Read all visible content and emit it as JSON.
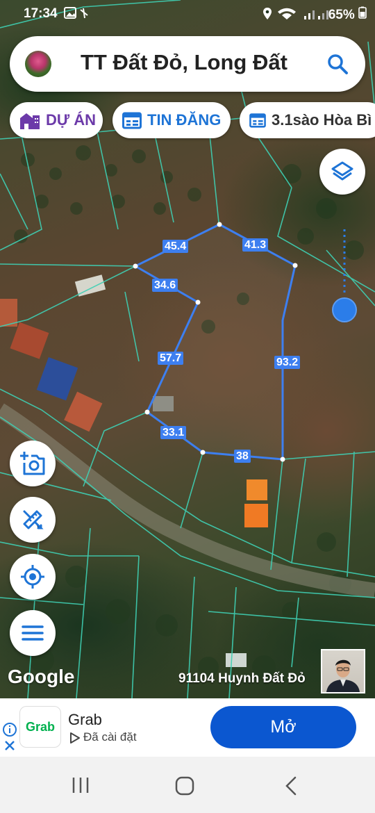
{
  "status_bar": {
    "time": "17:34",
    "battery": "65%"
  },
  "search": {
    "title": "TT Đất Đỏ, Long Đất"
  },
  "chips": {
    "du_an": "DỰ ÁN",
    "tin_dang": "TIN ĐĂNG",
    "listing": "3.1sào Hòa Bì"
  },
  "map": {
    "edge_labels": [
      "45.4",
      "41.3",
      "34.6",
      "57.7",
      "93.2",
      "33.1",
      "38"
    ],
    "attribution": "Google",
    "owner_label": "91104 Huynh Đất Đỏ"
  },
  "ad": {
    "app_name": "Grab",
    "logo_text": "Grab",
    "install_status": "Đã cài đặt",
    "open_button": "Mở"
  },
  "colors": {
    "accent_blue": "#3d7ff0",
    "du_an_purple": "#6c3aa9",
    "tin_dang_blue": "#1e74d6",
    "ad_button": "#0b57d0",
    "grab_green": "#00b14f"
  }
}
